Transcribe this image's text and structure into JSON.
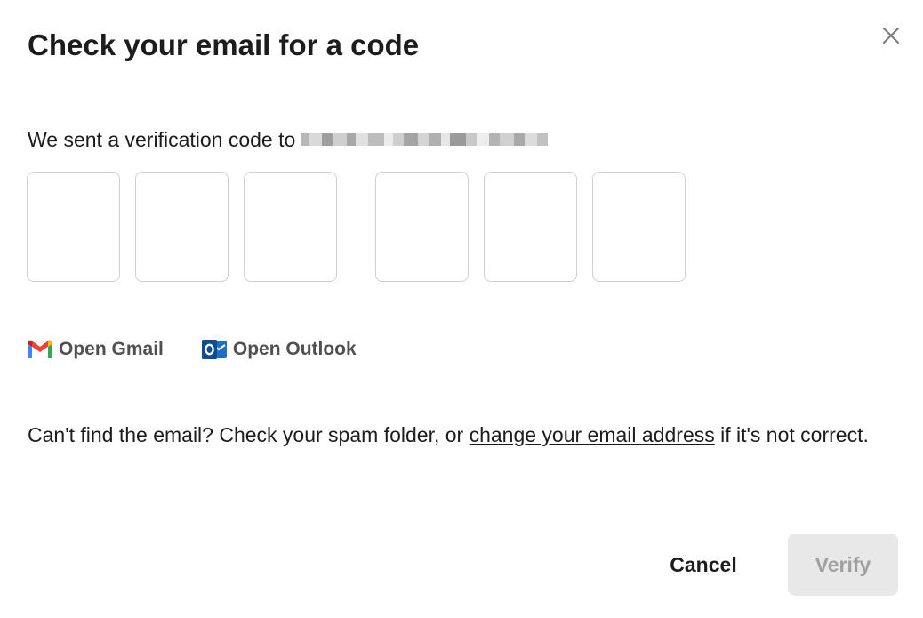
{
  "dialog": {
    "title": "Check your email for a code",
    "close_icon": "close-icon",
    "sent_prefix": "We sent a verification code to",
    "email_redacted": true,
    "code_inputs": [
      {
        "value": ""
      },
      {
        "value": ""
      },
      {
        "value": ""
      },
      {
        "value": ""
      },
      {
        "value": ""
      },
      {
        "value": ""
      }
    ],
    "open_links": {
      "gmail": {
        "label": "Open Gmail",
        "icon": "gmail-icon"
      },
      "outlook": {
        "label": "Open Outlook",
        "icon": "outlook-icon"
      }
    },
    "help": {
      "before": "Can't find the email? Check your spam folder, or ",
      "link": "change your email address",
      "after": " if it's not correct."
    },
    "buttons": {
      "cancel": "Cancel",
      "verify": "Verify"
    },
    "colors": {
      "gmail_red": "#EA4335",
      "gmail_blue": "#4285F4",
      "gmail_green": "#34A853",
      "gmail_yellow": "#FBBC04",
      "outlook_blue": "#0F6CBD",
      "verify_disabled_bg": "#E8E8E8",
      "verify_disabled_text": "#A0A0A0"
    }
  }
}
